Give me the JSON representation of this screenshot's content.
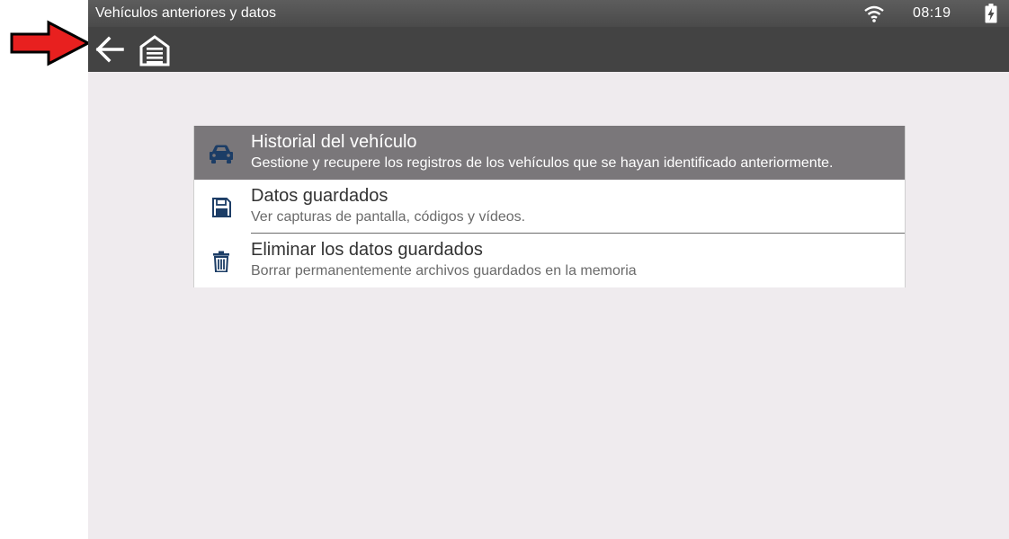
{
  "status_bar": {
    "title": "Vehículos anteriores y datos",
    "time": "08:19",
    "icons": [
      "wifi-icon",
      "battery-charging-icon"
    ]
  },
  "toolbar": {
    "icons": [
      "back-arrow-icon",
      "home-garage-icon"
    ]
  },
  "annotation": {
    "icon": "red-arrow-icon",
    "color": "#e8201f"
  },
  "menu": {
    "items": [
      {
        "title": "Historial del vehículo",
        "subtitle": "Gestione y recupere los registros de los vehículos que se hayan identificado anteriormente.",
        "icon": "car-icon",
        "selected": true
      },
      {
        "title": "Datos guardados",
        "subtitle": "Ver capturas de pantalla, códigos y vídeos.",
        "icon": "floppy-disk-icon",
        "selected": false
      },
      {
        "title": "Eliminar los datos guardados",
        "subtitle": "Borrar permanentemente archivos guardados en la memoria",
        "icon": "trash-icon",
        "selected": false
      }
    ]
  },
  "colors": {
    "status_bar": "#4f4f4f",
    "toolbar": "#434343",
    "background": "#efebee",
    "selected_row": "#7a777a",
    "icon_blue": "#1c3d66"
  }
}
